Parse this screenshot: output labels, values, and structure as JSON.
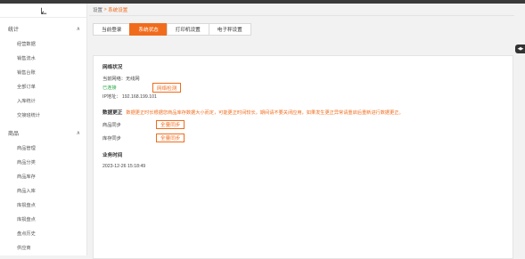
{
  "sidebar": {
    "groups": [
      {
        "title": "统计",
        "items": [
          "经营数据",
          "销售流水",
          "销售台账",
          "全部订单",
          "入库统计",
          "交接班统计"
        ]
      },
      {
        "title": "商品",
        "items": [
          "商品管理",
          "商品分类",
          "商品库存",
          "商品入库",
          "库损盘点",
          "库损盘点",
          "盘点历史",
          "供应商"
        ]
      }
    ]
  },
  "breadcrumb": {
    "parent": "设置",
    "sep": " > ",
    "current": "系统设置"
  },
  "tabs": [
    "当前登录",
    "系统状态",
    "打印机设置",
    "电子秤设置"
  ],
  "network": {
    "title": "网络状况",
    "current": "当前网络：无线网",
    "status": "已连接",
    "check_button": "网络检测",
    "ip": "IP地址： 192.168.199.101"
  },
  "sync": {
    "title": "数据更正",
    "warning": "数据更正时长根据您商品库存数据大小而定，可能更正时间较长，期间请不要关闭应用，如果发生更正异常请重启后重新进行数据更正。",
    "product_label": "商品同步",
    "stock_label": "库存同步",
    "sync_button": "全量同步"
  },
  "business_time": {
    "title": "业务时间",
    "value": "2023-12-26 15:18:49"
  },
  "colors": {
    "accent": "#f06c1c",
    "success": "#28a745"
  }
}
